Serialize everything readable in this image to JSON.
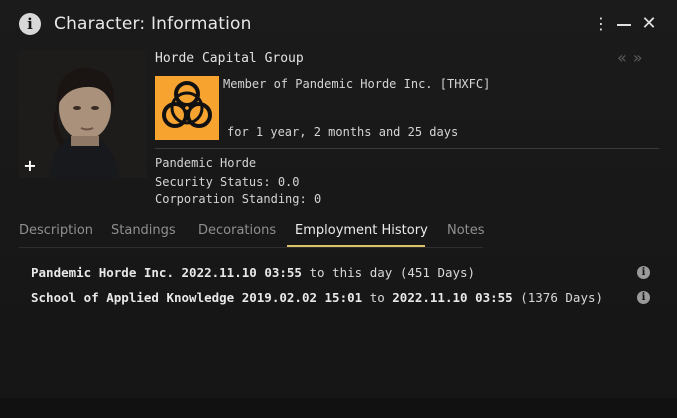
{
  "window": {
    "title": "Character: Information",
    "info_glyph": "i",
    "kebab_glyph": "⋮",
    "close_glyph": "✕"
  },
  "profile": {
    "name": "Horde Capital Group",
    "nav_arrows": "«»",
    "plus_glyph": "+",
    "corp_logo_icon": "biohazard-icon",
    "corp_logo_color": "#f6a330",
    "membership": "Member of Pandemic Horde Inc. [THXFC]",
    "duration": "for 1 year, 2 months and 25 days",
    "alliance": "Pandemic Horde",
    "security_status": "Security Status: 0.0",
    "corporation_standing": "Corporation Standing: 0"
  },
  "tabs": [
    {
      "label": "Description"
    },
    {
      "label": "Standings"
    },
    {
      "label": "Decorations"
    },
    {
      "label": "Employment History",
      "active": true
    },
    {
      "label": "Notes"
    }
  ],
  "accent_color": "#d9c06a",
  "history": [
    {
      "corp": "Pandemic Horde Inc.",
      "start": "2022.11.10 03:55",
      "connector": "to",
      "end": "this day",
      "days": "(451 Days)"
    },
    {
      "corp": "School of Applied Knowledge",
      "start": "2019.02.02 15:01",
      "connector": "to",
      "end": "2022.11.10 03:55",
      "days": "(1376 Days)"
    }
  ]
}
